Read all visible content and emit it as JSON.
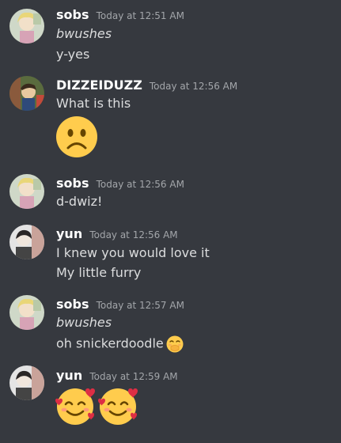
{
  "messages": [
    {
      "author": "sobs",
      "timestamp": "Today at 12:51 AM",
      "lines": [
        "bwushes",
        "y-yes"
      ]
    },
    {
      "author": "DIZZEIDUZZ",
      "timestamp": "Today at 12:56 AM",
      "lines": [
        "What is this"
      ],
      "emoji": "slightly-frowning-face-icon"
    },
    {
      "author": "sobs",
      "timestamp": "Today at 12:56 AM",
      "lines": [
        "d-dwiz!"
      ]
    },
    {
      "author": "yun",
      "timestamp": "Today at 12:56 AM",
      "lines": [
        "I knew you would love it",
        "My little furry"
      ]
    },
    {
      "author": "sobs",
      "timestamp": "Today at 12:57 AM",
      "lines": [
        "bwushes",
        "oh snickerdoodle"
      ],
      "emoji": "hand-over-mouth-face-icon"
    },
    {
      "author": "yun",
      "timestamp": "Today at 12:59 AM",
      "emoji": "smiling-face-with-hearts-icon"
    }
  ],
  "colors": {
    "background": "#36393f",
    "author": "#ffffff",
    "timestamp": "#a3a6aa",
    "text": "#dcddde",
    "emoji_yellow": "#ffcc4d"
  }
}
